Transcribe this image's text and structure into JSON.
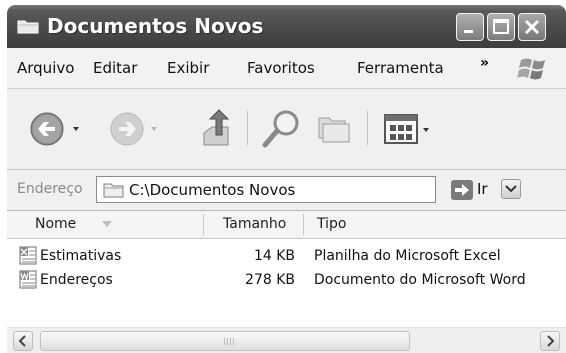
{
  "window": {
    "title": "Documentos Novos"
  },
  "menu": {
    "items": [
      "Arquivo",
      "Editar",
      "Exibir",
      "Favoritos",
      "Ferramenta"
    ],
    "overflow": "»"
  },
  "toolbar": {
    "buttons": [
      "back-icon",
      "forward-icon",
      "up-folder-icon",
      "search-icon",
      "folders-icon",
      "views-icon"
    ]
  },
  "address": {
    "label": "Endereço",
    "value": "C:\\Documentos Novos",
    "go_label": "Ir"
  },
  "list": {
    "columns": [
      "Nome",
      "Tamanho",
      "Tipo"
    ],
    "rows": [
      {
        "name": "Estimativas",
        "size": "14 KB",
        "type": "Planilha do Microsoft Excel",
        "icon": "excel-file-icon"
      },
      {
        "name": "Endereços",
        "size": "278 KB",
        "type": "Documento do Microsoft Word",
        "icon": "word-file-icon"
      }
    ]
  },
  "colors": {
    "titlebar": "#4a4a4a",
    "menubar": "#f2f2f2"
  }
}
